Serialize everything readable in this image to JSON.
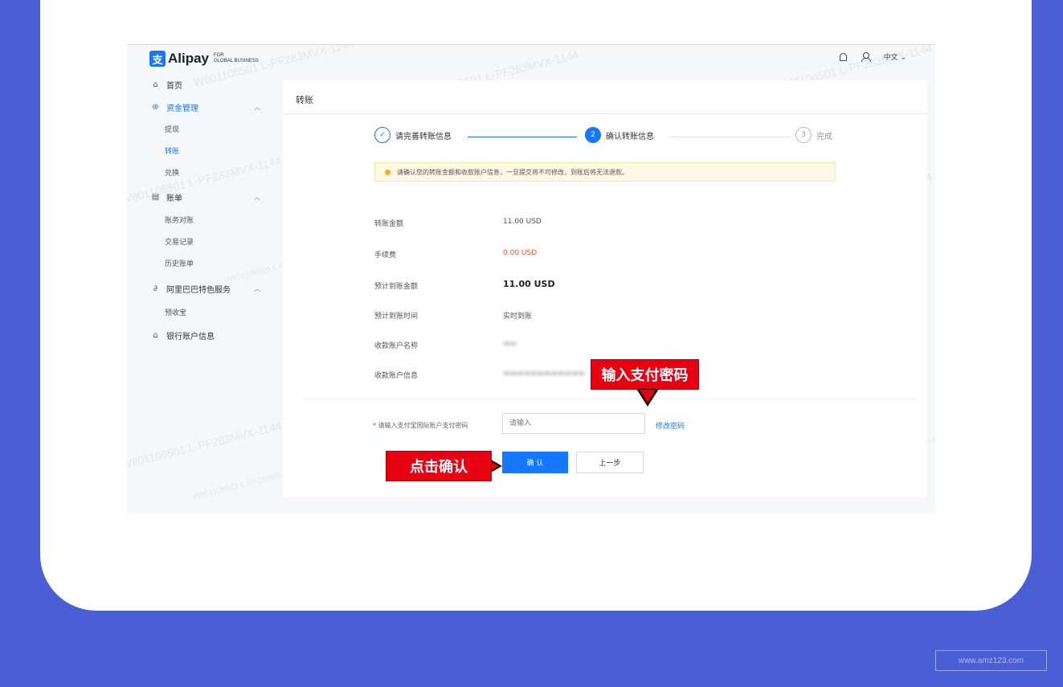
{
  "brand": {
    "name": "Alipay",
    "sub": "FOR\nGLOBAL BUSINESS"
  },
  "topbar": {
    "lang": "中文"
  },
  "sidebar": {
    "home": "首页",
    "funds": "资金管理",
    "funds_items": [
      "提现",
      "转账",
      "兑换"
    ],
    "bills": "账单",
    "bills_items": [
      "账务对账",
      "交易记录",
      "历史账单"
    ],
    "alibaba": "阿里巴巴特色服务",
    "alibaba_items": [
      "预收宝"
    ],
    "bank": "银行账户信息"
  },
  "panel": {
    "title": "转账",
    "steps": [
      {
        "num": "✓",
        "label": "请完善转账信息"
      },
      {
        "num": "2",
        "label": "确认转账信息"
      },
      {
        "num": "3",
        "label": "完成"
      }
    ],
    "notice": "请确认您的转账金额和收款账户信息，一旦提交将不可修改，到账后将无法退款。",
    "rows": [
      {
        "label": "转账金额",
        "value": "11.00 USD"
      },
      {
        "label": "手续费",
        "value": "0.00 USD"
      },
      {
        "label": "预计到账金额",
        "value": "11.00 USD"
      },
      {
        "label": "预计到账时间",
        "value": "实时到账"
      },
      {
        "label": "收款账户名称",
        "value": ""
      },
      {
        "label": "收款账户信息",
        "value": ""
      }
    ],
    "password_label": "请输入支付宝国际账户支付密码",
    "password_placeholder": "请输入",
    "forgot_link": "修改密码",
    "confirm_button": "确 认",
    "prev_button": "上一步"
  },
  "callouts": {
    "password": "输入支付密码",
    "confirm": "点击确认"
  },
  "watermark": "W801106501 L-PF283MVX-1144",
  "site_label": "www.amz123.com",
  "colors": {
    "accent": "#1677ff",
    "callout": "#e60012",
    "background": "#4a5fd6"
  }
}
